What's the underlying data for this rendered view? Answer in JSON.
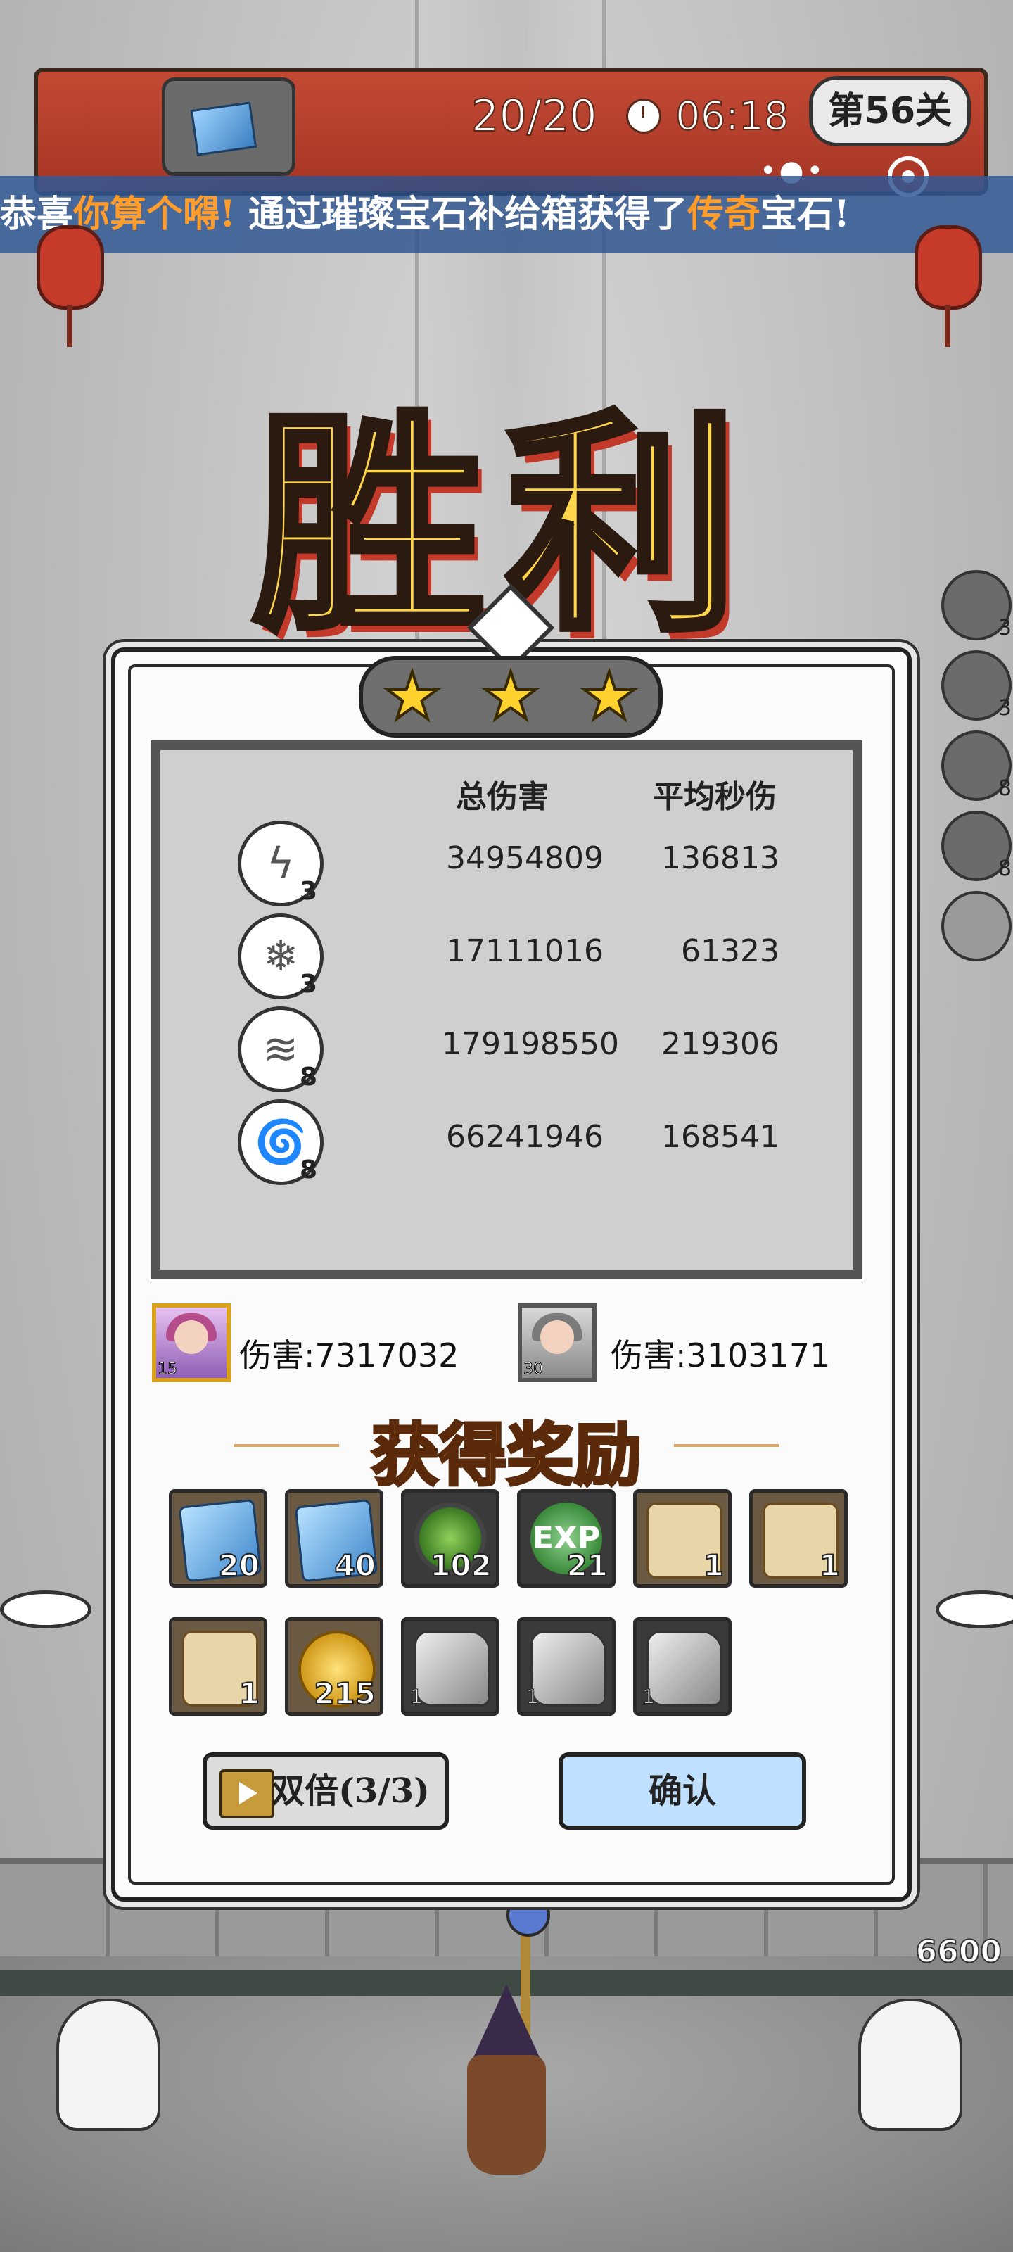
{
  "hud": {
    "progress": "20/20",
    "time": "06:18",
    "level": "第56关",
    "icons": [
      "chest-icon",
      "clock-icon",
      "more-icon",
      "target-icon"
    ]
  },
  "banner": {
    "prefix": "恭喜",
    "player": "你算个嘚!",
    "middle": " 通过璀璨宝石补给箱获得了",
    "rarity": "传奇",
    "suffix": "宝石!"
  },
  "victory_title": "胜利",
  "stars": 3,
  "stats": {
    "headers": {
      "total": "总伤害",
      "dps": "平均秒伤"
    },
    "rows": [
      {
        "icon": "lightning-skill-icon",
        "level": "3",
        "total": "34954809",
        "dps": "136813"
      },
      {
        "icon": "ice-crystal-skill-icon",
        "level": "3",
        "total": "17111016",
        "dps": "61323"
      },
      {
        "icon": "whirlwind-skill-icon",
        "level": "8",
        "total": "179198550",
        "dps": "219306"
      },
      {
        "icon": "tornado-skill-icon",
        "level": "8",
        "total": "66241946",
        "dps": "168541"
      }
    ]
  },
  "heroes": [
    {
      "level": "15",
      "damage": "伤害:7317032"
    },
    {
      "level": "30",
      "damage": "伤害:3103171"
    }
  ],
  "reward_title": "获得奖励",
  "rewards_row1": [
    {
      "icon": "blue-gem-icon",
      "count": "20"
    },
    {
      "icon": "blue-gem-icon",
      "count": "40"
    },
    {
      "icon": "green-essence-icon",
      "count": "102"
    },
    {
      "icon": "exp-icon",
      "count": "21"
    },
    {
      "icon": "boots-scroll-icon",
      "count": "1"
    },
    {
      "icon": "armor-scroll-icon",
      "count": "1"
    }
  ],
  "rewards_row2": [
    {
      "icon": "ring-scroll-icon",
      "count": "1"
    },
    {
      "icon": "gold-coin-icon",
      "count": "215"
    },
    {
      "icon": "stone-icon",
      "count": "1"
    },
    {
      "icon": "stone-icon",
      "count": "1"
    },
    {
      "icon": "stone-icon",
      "count": "1"
    }
  ],
  "exp_label": "EXP",
  "buttons": {
    "double": "双倍(3/3)",
    "confirm": "确认"
  },
  "side_icons": [
    "3",
    "3",
    "8",
    "8"
  ],
  "base_hp": "6600"
}
